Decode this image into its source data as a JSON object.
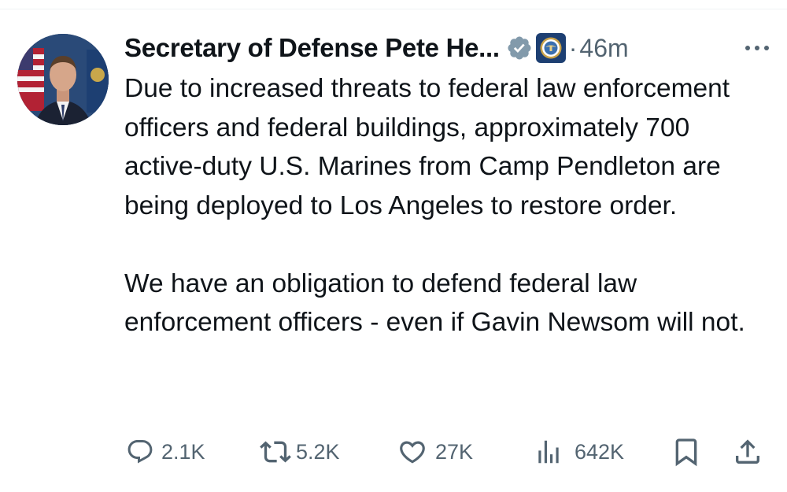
{
  "post": {
    "author": {
      "display_name": "Secretary of Defense Pete He...",
      "verified_badge_icon": "verified-badge-icon",
      "affiliation_icon": "department-of-defense-seal-icon"
    },
    "separator": "·",
    "time_ago": "46m",
    "paragraphs": [
      "Due to increased threats to federal law enforcement officers and federal buildings, approximately 700 active-duty U.S. Marines from Camp Pendleton are being deployed to Los Angeles to restore order.",
      "We have an obligation to defend federal law enforcement officers - even if Gavin Newsom will not."
    ],
    "actions": {
      "replies": "2.1K",
      "reposts": "5.2K",
      "likes": "27K",
      "views": "642K"
    }
  },
  "colors": {
    "text_primary": "#0f1419",
    "text_secondary": "#536471",
    "verified_badge": "#829aab",
    "affiliation_badge": "#1d3f72",
    "divider": "#eff3f4"
  }
}
